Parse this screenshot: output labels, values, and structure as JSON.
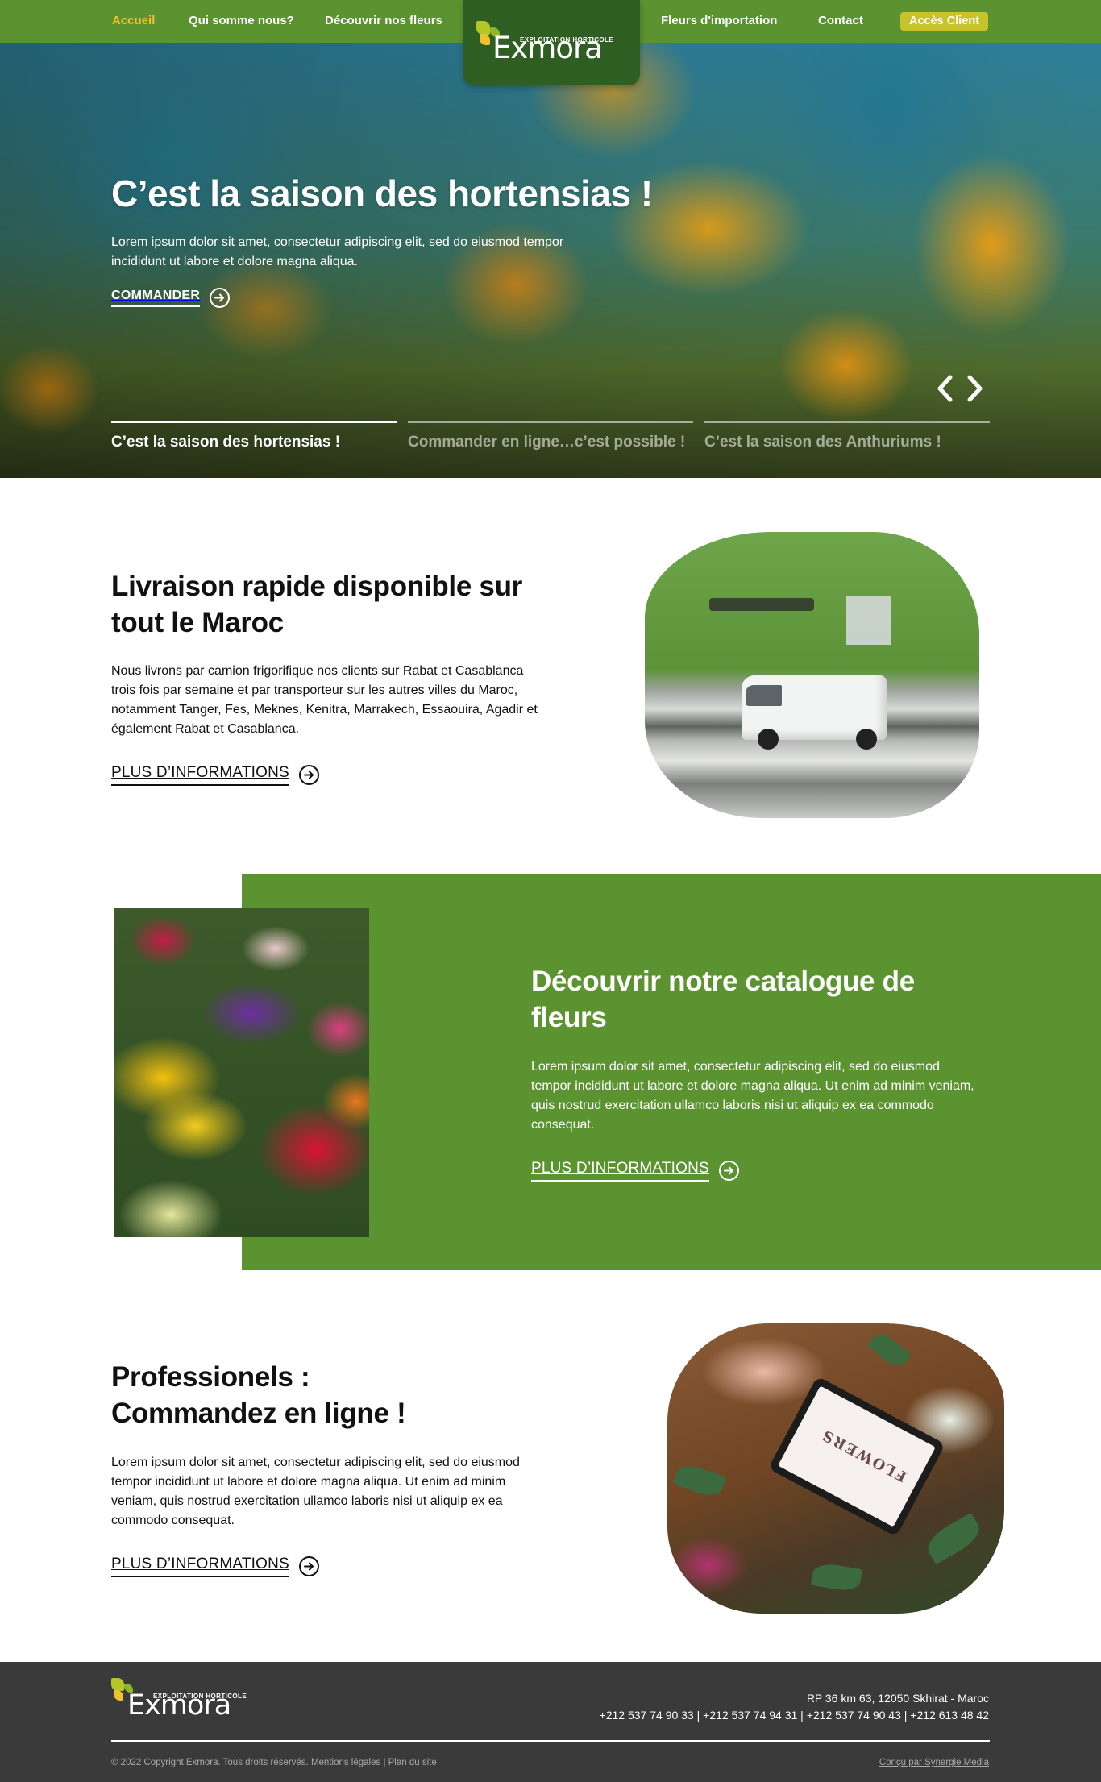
{
  "nav": {
    "items": [
      {
        "label": "Accueil",
        "active": true
      },
      {
        "label": "Qui somme nous?"
      },
      {
        "label": "Découvrir nos fleurs"
      },
      {
        "label": "Fleurs d'importation"
      },
      {
        "label": "Contact"
      }
    ],
    "client_button": "Accès Client"
  },
  "logo": {
    "word": "Exmora",
    "tagline": "EXPLOITATION HORTICOLE"
  },
  "hero": {
    "title": "C’est la saison des hortensias !",
    "lead": "Lorem ipsum dolor sit amet, consectetur adipiscing elit, sed do eiusmod tempor incididunt ut labore et dolore magna aliqua.",
    "cta": "COMMANDER",
    "slides": [
      {
        "caption": "C’est la saison des hortensias !",
        "active": true
      },
      {
        "caption": "Commander en ligne…c’est possible !",
        "active": false
      },
      {
        "caption": "C’est la saison des Anthuriums !",
        "active": false
      }
    ]
  },
  "delivery": {
    "title": "Livraison rapide disponible sur tout le Maroc",
    "text": "Nous livrons par camion frigorifique nos clients sur Rabat et Casablanca trois fois par semaine et par transporteur sur les autres villes du Maroc, notamment Tanger, Fes, Meknes, Kenitra, Marrakech, Essaouira, Agadir et également Rabat et Casablanca.",
    "more": "PLUS D’INFORMATIONS"
  },
  "catalogue": {
    "title": "Découvrir notre catalogue de fleurs",
    "text": "Lorem ipsum dolor sit amet, consectetur adipiscing elit, sed do eiusmod tempor incididunt ut labore et dolore magna aliqua. Ut enim ad minim veniam, quis nostrud exercitation ullamco laboris nisi ut aliquip ex ea commodo consequat.",
    "more": "PLUS D’INFORMATIONS"
  },
  "pros": {
    "title_line1": "Professionels :",
    "title_line2": "Commandez en ligne !",
    "text": "Lorem ipsum dolor sit amet, consectetur adipiscing elit, sed do eiusmod tempor incididunt ut labore et dolore magna aliqua. Ut enim ad minim veniam, quis nostrud exercitation ullamco laboris nisi ut aliquip ex ea commodo consequat.",
    "more": "PLUS D’INFORMATIONS",
    "tablet_text": "FLOWERS"
  },
  "footer": {
    "address": "RP 36 km 63, 12050 Skhirat - Maroc",
    "phones": "+212 537 74 90 33 | +212 537 74 94 31 | +212 537 74 90 43 | +212 613 48 42",
    "copyright": "© 2022 Copyright Exmora. Tous droits réservés. Mentions légales | Plan du site",
    "credit": "Conçu par Synergie Media"
  },
  "colors": {
    "brand_green": "#5b9331",
    "dark_green": "#2f5e23",
    "accent_yellow": "#f2c12e",
    "client_button": "#c8c22b",
    "footer": "#3a3a3a"
  }
}
